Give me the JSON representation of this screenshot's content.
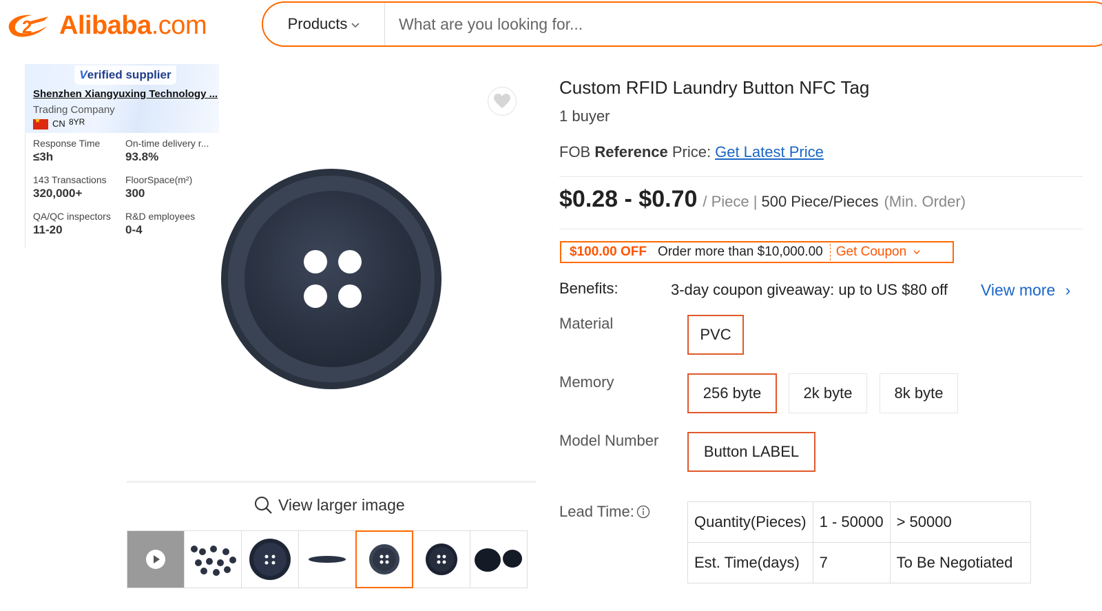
{
  "header": {
    "logo_brand": "Alibaba",
    "logo_domain": ".com",
    "search_category": "Products",
    "search_placeholder": "What are you looking for..."
  },
  "supplier": {
    "badge_v": "V",
    "badge_rest": "erified supplier",
    "name": "Shenzhen Xiangyuxing Technology ...",
    "company_type": "Trading Company",
    "country": "CN",
    "years": "8YR",
    "stats": [
      {
        "label": "Response Time",
        "value": "≤3h"
      },
      {
        "label": "On-time delivery r...",
        "value": "93.8%"
      },
      {
        "label": "143 Transactions",
        "value": "320,000+"
      },
      {
        "label": "FloorSpace(m²)",
        "value": "300"
      },
      {
        "label": "QA/QC inspectors",
        "value": "11-20"
      },
      {
        "label": "R&D employees",
        "value": "0-4"
      }
    ]
  },
  "gallery": {
    "view_larger": "View larger image",
    "thumbnail_count": 7,
    "active_thumbnail": 5
  },
  "product": {
    "title": "Custom RFID Laundry Button NFC Tag",
    "buyers": "1 buyer",
    "fob_prefix": "FOB ",
    "fob_bold": "Reference",
    "fob_suffix": " Price:",
    "fob_link": "Get Latest Price",
    "price_range": "$0.28 - $0.70",
    "price_unit": "/ Piece |",
    "moq": "500 Piece/Pieces",
    "moq_label": "(Min. Order)"
  },
  "coupon": {
    "discount": "$100.00 OFF",
    "condition": "Order more than $10,000.00",
    "action": "Get Coupon"
  },
  "benefits": {
    "label": "Benefits:",
    "text": "3-day coupon giveaway: up to US $80 off",
    "link": "View more",
    "chevron": "›"
  },
  "attributes": {
    "material_label": "Material",
    "material_options": [
      "PVC"
    ],
    "memory_label": "Memory",
    "memory_options": [
      "256 byte",
      "2k byte",
      "8k byte"
    ],
    "model_label": "Model Number",
    "model_options": [
      "Button LABEL"
    ]
  },
  "lead_time": {
    "label": "Lead Time:",
    "rows": [
      [
        "Quantity(Pieces)",
        "1 - 50000",
        "> 50000"
      ],
      [
        "Est. Time(days)",
        "7",
        "To Be Negotiated"
      ]
    ]
  },
  "colors": {
    "brand_orange": "#ff6a00",
    "link_blue": "#1a66c6",
    "coupon_red": "#ff5500",
    "selected_border": "#e0592a"
  }
}
